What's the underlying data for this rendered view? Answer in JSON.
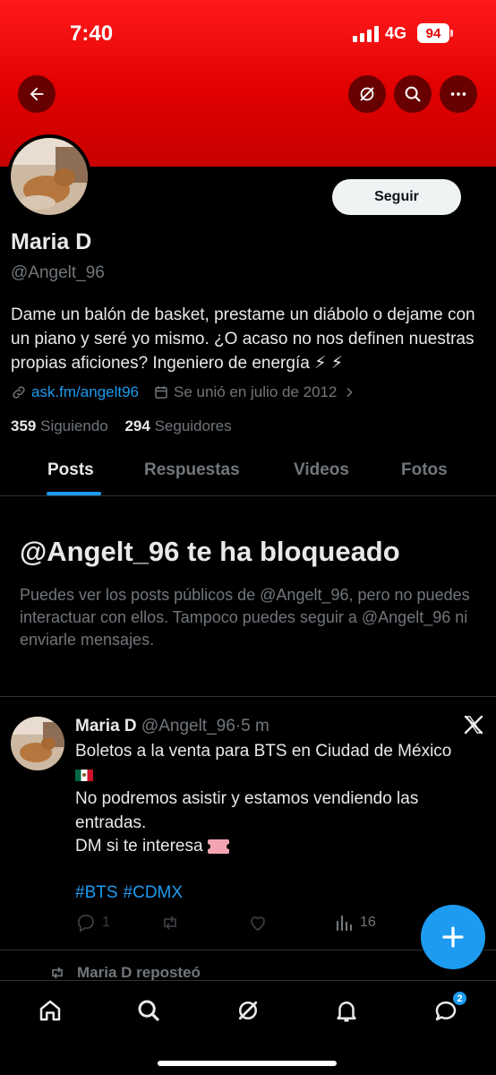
{
  "status_bar": {
    "time": "7:40",
    "network": "4G",
    "battery": "94"
  },
  "colors": {
    "header_red": "#e00000",
    "accent_blue": "#1d9bf0",
    "background": "#000000",
    "muted_text": "#71767b"
  },
  "header": {
    "back_icon": "arrow-left-icon",
    "icons": [
      "grok-icon",
      "search-icon",
      "more-icon"
    ]
  },
  "profile": {
    "follow_label": "Seguir",
    "name": "Maria D",
    "handle": "@Angelt_96",
    "bio": "Dame un balón de basket, prestame un diábolo o dejame con un piano y seré yo mismo. ¿O acaso no nos definen nuestras propias aficiones? Ingeniero de energía ⚡ ⚡",
    "link": "ask.fm/angelt96",
    "joined": "Se unió en julio de 2012",
    "following_count": "359",
    "following_label": "Siguiendo",
    "followers_count": "294",
    "followers_label": "Seguidores"
  },
  "tabs": [
    "Posts",
    "Respuestas",
    "Videos",
    "Fotos"
  ],
  "blocked": {
    "title": "@Angelt_96 te ha bloqueado",
    "text": "Puedes ver los posts públicos de @Angelt_96, pero no puedes interactuar con ellos. Tampoco puedes seguir a @Angelt_96 ni enviarle mensajes."
  },
  "post": {
    "author": "Maria D",
    "handle": "@Angelt_96",
    "sep": "·",
    "time": "5 m",
    "line1": "Boletos a la venta para BTS en Ciudad de México",
    "line2": "No podremos asistir y estamos vendiendo las entradas.",
    "line3": "DM si te interesa",
    "hashtags": [
      "#BTS",
      "#CDMX"
    ],
    "replies": "1",
    "views": "16"
  },
  "repost": {
    "label": "Maria D reposteó"
  },
  "nav": {
    "messages_badge": "2"
  }
}
